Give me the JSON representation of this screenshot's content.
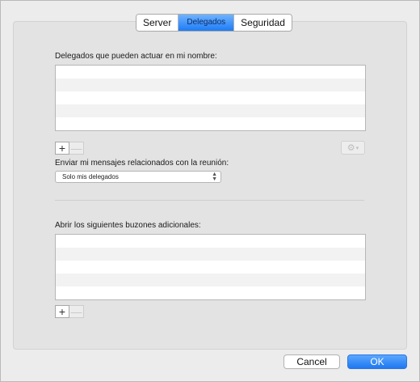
{
  "tabs": [
    {
      "label": "Server"
    },
    {
      "label": "Delegados",
      "selected": true
    },
    {
      "label": "Seguridad"
    }
  ],
  "delegates": {
    "label": "Delegados que pueden actuar en mi nombre:",
    "items": []
  },
  "meeting_messages": {
    "label": "Enviar mi mensajes relacionados con la reunión:",
    "selected": "Solo mis delegados"
  },
  "mailboxes": {
    "label": "Abrir los siguientes buzones adicionales:",
    "items": []
  },
  "icons": {
    "add": "+",
    "remove": "—",
    "gear": "gear-icon"
  },
  "footer": {
    "cancel_label": "Cancel",
    "ok_label": "OK"
  },
  "colors": {
    "accent": "#1f78f0"
  }
}
